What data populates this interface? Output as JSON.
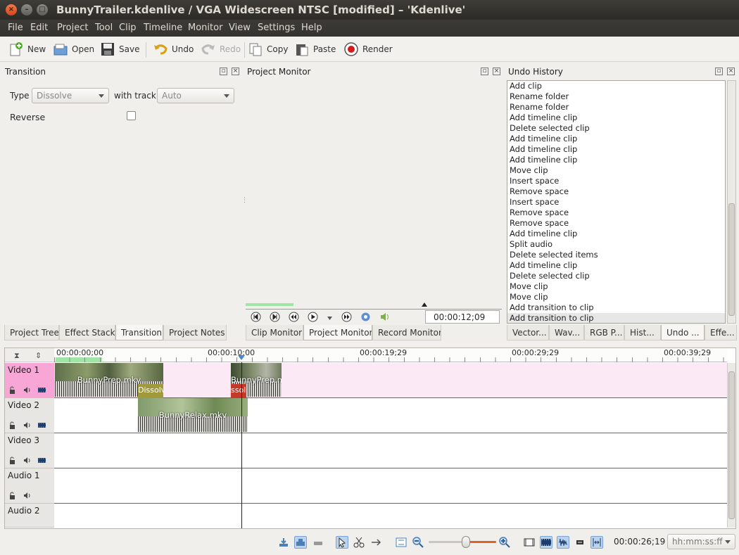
{
  "window": {
    "title": "BunnyTrailer.kdenlive / VGA Widescreen NTSC [modified] – 'Kdenlive'",
    "close_glyph": "×",
    "min_glyph": "–",
    "max_glyph": "□"
  },
  "menu": [
    "File",
    "Edit",
    "Project",
    "Tool",
    "Clip",
    "Timeline",
    "Monitor",
    "View",
    "Settings",
    "Help"
  ],
  "toolbar": {
    "new": "New",
    "open": "Open",
    "save": "Save",
    "undo": "Undo",
    "redo": "Redo",
    "copy": "Copy",
    "paste": "Paste",
    "render": "Render"
  },
  "transition_panel": {
    "title": "Transition",
    "type_label": "Type",
    "type_value": "Dissolve",
    "with_track_label": "with track",
    "with_track_value": "Auto",
    "reverse_label": "Reverse"
  },
  "project_monitor": {
    "title": "Project Monitor",
    "timecode": "00:00:12;09"
  },
  "undo_history": {
    "title": "Undo History",
    "items": [
      "Add clip",
      "Rename folder",
      "Rename folder",
      "Add timeline clip",
      "Delete selected clip",
      "Add timeline clip",
      "Add timeline clip",
      "Add timeline clip",
      "Move clip",
      "Insert space",
      "Remove space",
      "Insert space",
      "Remove space",
      "Remove space",
      "Add timeline clip",
      "Split audio",
      "Delete selected items",
      "Add timeline clip",
      "Delete selected clip",
      "Move clip",
      "Move clip",
      "Add transition to clip",
      "Add transition to clip"
    ]
  },
  "left_tabs": [
    "Project Tree",
    "Effect Stack",
    "Transition",
    "Project Notes"
  ],
  "monitor_tabs": [
    "Clip Monitor",
    "Project Monitor",
    "Record Monitor"
  ],
  "right_tabs": [
    "Vector...",
    "Wav...",
    "RGB P...",
    "Hist...",
    "Undo ...",
    "Effe..."
  ],
  "ruler": [
    "00:00:00;00",
    "00:00:10;00",
    "00:00:19;29",
    "00:00:29;29",
    "00:00:39;29"
  ],
  "tracks": [
    "Video 1",
    "Video 2",
    "Video 3",
    "Audio 1",
    "Audio 2"
  ],
  "clips": {
    "v1a": "BunnyPrep.mkv",
    "v1b": "BunnyPrep.mk",
    "v2": "BunnyRelax.mkv",
    "trans1": "Dissolv",
    "trans2": "ssol"
  },
  "statusbar": {
    "timecode": "00:00:26;19",
    "format": "hh:mm:ss:ff",
    "zoom_level": 0.55
  },
  "colors": {
    "selected_track": "#f7a6d6",
    "transition": "#c43a2a",
    "accent": "#2f6fd6"
  }
}
